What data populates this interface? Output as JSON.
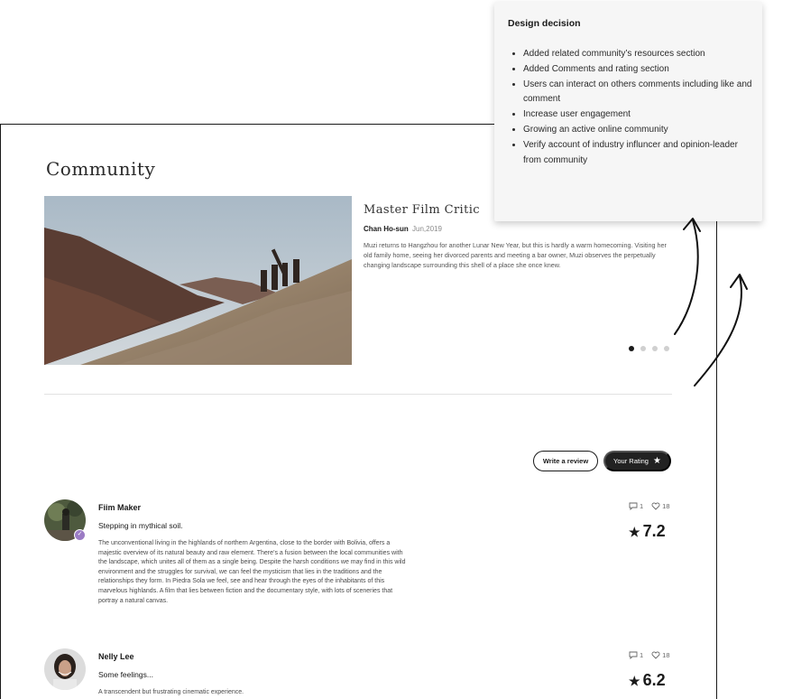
{
  "page": {
    "title": "Community"
  },
  "feature": {
    "title": "Master Film Critic",
    "author": "Chan Ho-sun",
    "date": "Jun,2019",
    "description": "Muzi returns to Hangzhou for another Lunar New Year, but this is hardly a warm homecoming. Visiting her old family home, seeing her divorced parents and meeting a bar owner, Muzi observes the perpetually changing landscape surrounding this shell of a place she once knew.",
    "carousel": {
      "count": 4,
      "active": 0
    }
  },
  "actions": {
    "write_review": "Write a review",
    "your_rating": "Your Rating"
  },
  "reviews": [
    {
      "name": "Fiim Maker",
      "verified": true,
      "headline": "Stepping in mythical soil.",
      "body": "The unconventional living in the highlands of northern Argentina, close to the border with Bolivia, offers a majestic overview of its natural beauty and raw element. There’s a fusion between the local communities with the landscape, which unites all of them as a single being. Despite the harsh conditions we may find in this wild environment and the struggles for survival, we can feel the mysticism that lies in the traditions and the relationships they form. In Piedra Sola we feel, see and hear through the eyes of the inhabitants of this marvelous highlands. A film that lies between fiction and the documentary style, with lots of sceneries that portray a natural canvas.",
      "comments": "1",
      "likes": "18",
      "score": "7.2"
    },
    {
      "name": "Nelly Lee",
      "verified": false,
      "headline": "Some feelings...",
      "body": "A transcendent but frustrating cinematic experience.",
      "comments": "1",
      "likes": "18",
      "score": "6.2"
    }
  ],
  "design_decision": {
    "title": "Design decision",
    "items": [
      "Added  related community’s resources  section",
      "Added Comments and rating section",
      "Users can interact on others comments including like and comment",
      "Increase user engagement",
      "Growing an active online community",
      "Verify account of industry influncer and opinion-leader from community"
    ]
  },
  "icons": {
    "comment": "comment-icon",
    "like": "heart-icon",
    "star": "star-icon",
    "verified": "check-badge-icon"
  },
  "colors": {
    "dark_button": "#222222",
    "verified_badge": "#9b7bc4",
    "panel_background": "#f6f6f6"
  }
}
